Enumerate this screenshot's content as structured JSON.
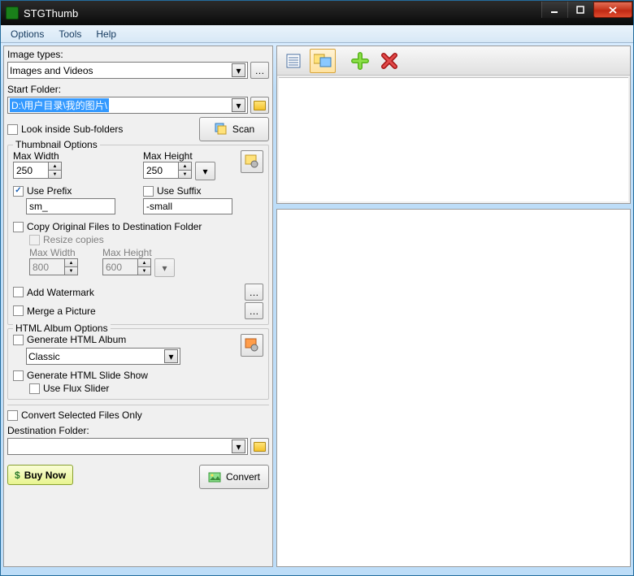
{
  "title": "STGThumb",
  "menu": {
    "options": "Options",
    "tools": "Tools",
    "help": "Help"
  },
  "imageTypes": {
    "label": "Image types:",
    "value": "Images and Videos"
  },
  "startFolder": {
    "label": "Start Folder:",
    "value": "D:\\用户目录\\我的图片\\"
  },
  "lookInside": {
    "label": "Look inside Sub-folders",
    "checked": false
  },
  "scanBtn": "Scan",
  "thumbOpts": {
    "title": "Thumbnail Options",
    "maxW": {
      "label": "Max Width",
      "value": "250"
    },
    "maxH": {
      "label": "Max Height",
      "value": "250"
    },
    "usePrefix": {
      "label": "Use Prefix",
      "checked": true,
      "value": "sm_"
    },
    "useSuffix": {
      "label": "Use Suffix",
      "checked": false,
      "value": "-small"
    },
    "copyOrig": {
      "label": "Copy Original Files to Destination Folder",
      "checked": false
    },
    "resizeCopies": {
      "label": "Resize copies",
      "checked": false
    },
    "copyMaxW": {
      "label": "Max Width",
      "value": "800"
    },
    "copyMaxH": {
      "label": "Max Height",
      "value": "600"
    },
    "addWatermark": {
      "label": "Add Watermark",
      "checked": false
    },
    "mergePicture": {
      "label": "Merge a Picture",
      "checked": false
    }
  },
  "htmlOpts": {
    "title": "HTML Album Options",
    "generate": {
      "label": "Generate HTML Album",
      "checked": false
    },
    "template": "Classic",
    "slideshow": {
      "label": "Generate HTML Slide Show",
      "checked": false
    },
    "flux": {
      "label": "Use Flux Slider",
      "checked": false
    }
  },
  "convertSelected": {
    "label": "Convert Selected Files Only",
    "checked": false
  },
  "dest": {
    "label": "Destination Folder:",
    "value": ""
  },
  "buyNow": "Buy Now",
  "convertBtn": "Convert"
}
